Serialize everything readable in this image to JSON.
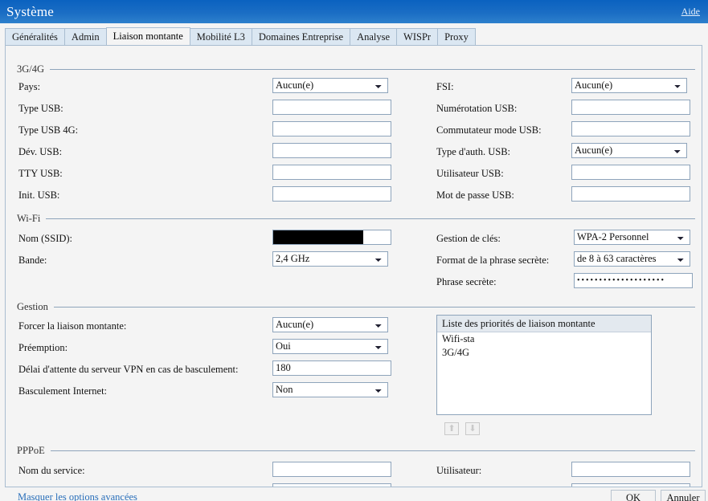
{
  "window": {
    "title": "Système",
    "help_link": "Aide"
  },
  "tabs": [
    {
      "label": "Généralités",
      "active": false
    },
    {
      "label": "Admin",
      "active": false
    },
    {
      "label": "Liaison montante",
      "active": true
    },
    {
      "label": "Mobilité L3",
      "active": false
    },
    {
      "label": "Domaines Entreprise",
      "active": false
    },
    {
      "label": "Analyse",
      "active": false
    },
    {
      "label": "WISPr",
      "active": false
    },
    {
      "label": "Proxy",
      "active": false
    }
  ],
  "sections": {
    "cellular": {
      "legend": "3G/4G",
      "left": [
        {
          "label": "Pays:",
          "type": "select",
          "value": "Aucun(e)"
        },
        {
          "label": "Type USB:",
          "type": "text",
          "value": ""
        },
        {
          "label": "Type USB 4G:",
          "type": "text",
          "value": ""
        },
        {
          "label": "Dév. USB:",
          "type": "text",
          "value": ""
        },
        {
          "label": "TTY USB:",
          "type": "text",
          "value": ""
        },
        {
          "label": "Init. USB:",
          "type": "text",
          "value": ""
        }
      ],
      "right": [
        {
          "label": "FSI:",
          "type": "select",
          "value": "Aucun(e)"
        },
        {
          "label": "Numérotation USB:",
          "type": "text",
          "value": ""
        },
        {
          "label": "Commutateur mode USB:",
          "type": "text",
          "value": ""
        },
        {
          "label": "Type d'auth. USB:",
          "type": "select",
          "value": "Aucun(e)"
        },
        {
          "label": "Utilisateur USB:",
          "type": "text",
          "value": ""
        },
        {
          "label": "Mot de passe USB:",
          "type": "text",
          "value": ""
        }
      ]
    },
    "wifi": {
      "legend": "Wi-Fi",
      "left": [
        {
          "label": "Nom (SSID):",
          "type": "text",
          "value": "",
          "redacted": true
        },
        {
          "label": "Bande:",
          "type": "select",
          "value": "2,4 GHz"
        }
      ],
      "right": [
        {
          "label": "Gestion de clés:",
          "type": "select",
          "value": "WPA-2 Personnel"
        },
        {
          "label": "Format de la phrase secrète:",
          "type": "select",
          "value": "de 8 à 63 caractères"
        },
        {
          "label": "Phrase secrète:",
          "type": "password",
          "value": "••••••••••••••••••••"
        }
      ]
    },
    "management": {
      "legend": "Gestion",
      "left": [
        {
          "label": "Forcer la liaison montante:",
          "type": "select",
          "value": "Aucun(e)"
        },
        {
          "label": "Préemption:",
          "type": "select",
          "value": "Oui"
        },
        {
          "label": "Délai d'attente du serveur VPN en cas de basculement:",
          "type": "text",
          "value": "180"
        },
        {
          "label": "Basculement Internet:",
          "type": "select",
          "value": "Non"
        }
      ],
      "priority_list": {
        "header": "Liste des priorités de liaison montante",
        "items": [
          "Wifi-sta",
          "3G/4G"
        ],
        "move_up_icon": "arrow-up-icon",
        "move_down_icon": "arrow-down-icon"
      }
    },
    "pppoe": {
      "legend": "PPPoE",
      "left": [
        {
          "label": "Nom du service:",
          "type": "text",
          "value": ""
        }
      ],
      "right": [
        {
          "label": "Utilisateur:",
          "type": "text",
          "value": ""
        }
      ]
    }
  },
  "footer": {
    "advanced_link": "Masquer les options avancées",
    "ok_label": "OK",
    "cancel_label": "Annuler"
  },
  "colors": {
    "title_bar_top": "#0a62c0",
    "title_bar_bottom": "#2d80cc",
    "tab_inactive": "#dbe7f2",
    "panel_bg": "#f4f4f4",
    "border": "#8ea4bb",
    "link": "#2a6fba"
  }
}
